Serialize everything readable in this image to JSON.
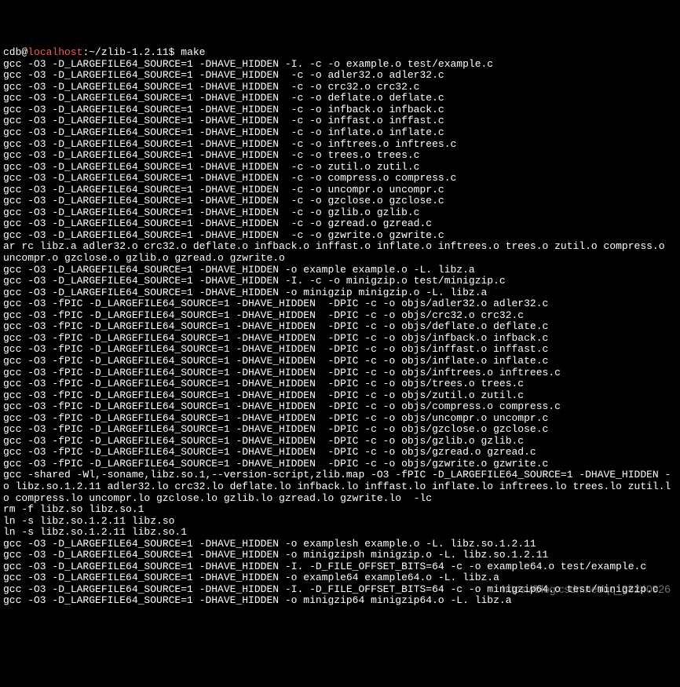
{
  "prompt": {
    "user": "cdb",
    "at": "@",
    "host": "localhost",
    "colon": ":",
    "path": "~/zlib-1.2.11",
    "dollar": "$ ",
    "command": "make"
  },
  "lines": [
    "gcc -O3 -D_LARGEFILE64_SOURCE=1 -DHAVE_HIDDEN -I. -c -o example.o test/example.c",
    "gcc -O3 -D_LARGEFILE64_SOURCE=1 -DHAVE_HIDDEN  -c -o adler32.o adler32.c",
    "gcc -O3 -D_LARGEFILE64_SOURCE=1 -DHAVE_HIDDEN  -c -o crc32.o crc32.c",
    "gcc -O3 -D_LARGEFILE64_SOURCE=1 -DHAVE_HIDDEN  -c -o deflate.o deflate.c",
    "gcc -O3 -D_LARGEFILE64_SOURCE=1 -DHAVE_HIDDEN  -c -o infback.o infback.c",
    "gcc -O3 -D_LARGEFILE64_SOURCE=1 -DHAVE_HIDDEN  -c -o inffast.o inffast.c",
    "gcc -O3 -D_LARGEFILE64_SOURCE=1 -DHAVE_HIDDEN  -c -o inflate.o inflate.c",
    "gcc -O3 -D_LARGEFILE64_SOURCE=1 -DHAVE_HIDDEN  -c -o inftrees.o inftrees.c",
    "gcc -O3 -D_LARGEFILE64_SOURCE=1 -DHAVE_HIDDEN  -c -o trees.o trees.c",
    "gcc -O3 -D_LARGEFILE64_SOURCE=1 -DHAVE_HIDDEN  -c -o zutil.o zutil.c",
    "gcc -O3 -D_LARGEFILE64_SOURCE=1 -DHAVE_HIDDEN  -c -o compress.o compress.c",
    "gcc -O3 -D_LARGEFILE64_SOURCE=1 -DHAVE_HIDDEN  -c -o uncompr.o uncompr.c",
    "gcc -O3 -D_LARGEFILE64_SOURCE=1 -DHAVE_HIDDEN  -c -o gzclose.o gzclose.c",
    "gcc -O3 -D_LARGEFILE64_SOURCE=1 -DHAVE_HIDDEN  -c -o gzlib.o gzlib.c",
    "gcc -O3 -D_LARGEFILE64_SOURCE=1 -DHAVE_HIDDEN  -c -o gzread.o gzread.c",
    "gcc -O3 -D_LARGEFILE64_SOURCE=1 -DHAVE_HIDDEN  -c -o gzwrite.o gzwrite.c",
    "ar rc libz.a adler32.o crc32.o deflate.o infback.o inffast.o inflate.o inftrees.o trees.o zutil.o compress.o uncompr.o gzclose.o gzlib.o gzread.o gzwrite.o",
    "gcc -O3 -D_LARGEFILE64_SOURCE=1 -DHAVE_HIDDEN -o example example.o -L. libz.a",
    "gcc -O3 -D_LARGEFILE64_SOURCE=1 -DHAVE_HIDDEN -I. -c -o minigzip.o test/minigzip.c",
    "gcc -O3 -D_LARGEFILE64_SOURCE=1 -DHAVE_HIDDEN -o minigzip minigzip.o -L. libz.a",
    "gcc -O3 -fPIC -D_LARGEFILE64_SOURCE=1 -DHAVE_HIDDEN  -DPIC -c -o objs/adler32.o adler32.c",
    "gcc -O3 -fPIC -D_LARGEFILE64_SOURCE=1 -DHAVE_HIDDEN  -DPIC -c -o objs/crc32.o crc32.c",
    "gcc -O3 -fPIC -D_LARGEFILE64_SOURCE=1 -DHAVE_HIDDEN  -DPIC -c -o objs/deflate.o deflate.c",
    "gcc -O3 -fPIC -D_LARGEFILE64_SOURCE=1 -DHAVE_HIDDEN  -DPIC -c -o objs/infback.o infback.c",
    "gcc -O3 -fPIC -D_LARGEFILE64_SOURCE=1 -DHAVE_HIDDEN  -DPIC -c -o objs/inffast.o inffast.c",
    "gcc -O3 -fPIC -D_LARGEFILE64_SOURCE=1 -DHAVE_HIDDEN  -DPIC -c -o objs/inflate.o inflate.c",
    "gcc -O3 -fPIC -D_LARGEFILE64_SOURCE=1 -DHAVE_HIDDEN  -DPIC -c -o objs/inftrees.o inftrees.c",
    "gcc -O3 -fPIC -D_LARGEFILE64_SOURCE=1 -DHAVE_HIDDEN  -DPIC -c -o objs/trees.o trees.c",
    "gcc -O3 -fPIC -D_LARGEFILE64_SOURCE=1 -DHAVE_HIDDEN  -DPIC -c -o objs/zutil.o zutil.c",
    "gcc -O3 -fPIC -D_LARGEFILE64_SOURCE=1 -DHAVE_HIDDEN  -DPIC -c -o objs/compress.o compress.c",
    "gcc -O3 -fPIC -D_LARGEFILE64_SOURCE=1 -DHAVE_HIDDEN  -DPIC -c -o objs/uncompr.o uncompr.c",
    "gcc -O3 -fPIC -D_LARGEFILE64_SOURCE=1 -DHAVE_HIDDEN  -DPIC -c -o objs/gzclose.o gzclose.c",
    "gcc -O3 -fPIC -D_LARGEFILE64_SOURCE=1 -DHAVE_HIDDEN  -DPIC -c -o objs/gzlib.o gzlib.c",
    "gcc -O3 -fPIC -D_LARGEFILE64_SOURCE=1 -DHAVE_HIDDEN  -DPIC -c -o objs/gzread.o gzread.c",
    "gcc -O3 -fPIC -D_LARGEFILE64_SOURCE=1 -DHAVE_HIDDEN  -DPIC -c -o objs/gzwrite.o gzwrite.c",
    "gcc -shared -Wl,-soname,libz.so.1,--version-script,zlib.map -O3 -fPIC -D_LARGEFILE64_SOURCE=1 -DHAVE_HIDDEN -o libz.so.1.2.11 adler32.lo crc32.lo deflate.lo infback.lo inffast.lo inflate.lo inftrees.lo trees.lo zutil.lo compress.lo uncompr.lo gzclose.lo gzlib.lo gzread.lo gzwrite.lo  -lc",
    "rm -f libz.so libz.so.1",
    "ln -s libz.so.1.2.11 libz.so",
    "ln -s libz.so.1.2.11 libz.so.1",
    "gcc -O3 -D_LARGEFILE64_SOURCE=1 -DHAVE_HIDDEN -o examplesh example.o -L. libz.so.1.2.11",
    "gcc -O3 -D_LARGEFILE64_SOURCE=1 -DHAVE_HIDDEN -o minigzipsh minigzip.o -L. libz.so.1.2.11",
    "gcc -O3 -D_LARGEFILE64_SOURCE=1 -DHAVE_HIDDEN -I. -D_FILE_OFFSET_BITS=64 -c -o example64.o test/example.c",
    "gcc -O3 -D_LARGEFILE64_SOURCE=1 -DHAVE_HIDDEN -o example64 example64.o -L. libz.a",
    "gcc -O3 -D_LARGEFILE64_SOURCE=1 -DHAVE_HIDDEN -I. -D_FILE_OFFSET_BITS=64 -c -o minigzip64.o test/minigzip.c",
    "gcc -O3 -D_LARGEFILE64_SOURCE=1 -DHAVE_HIDDEN -o minigzip64 minigzip64.o -L. libz.a"
  ],
  "watermark": "https://blog.csdn.net/qq_38240926"
}
